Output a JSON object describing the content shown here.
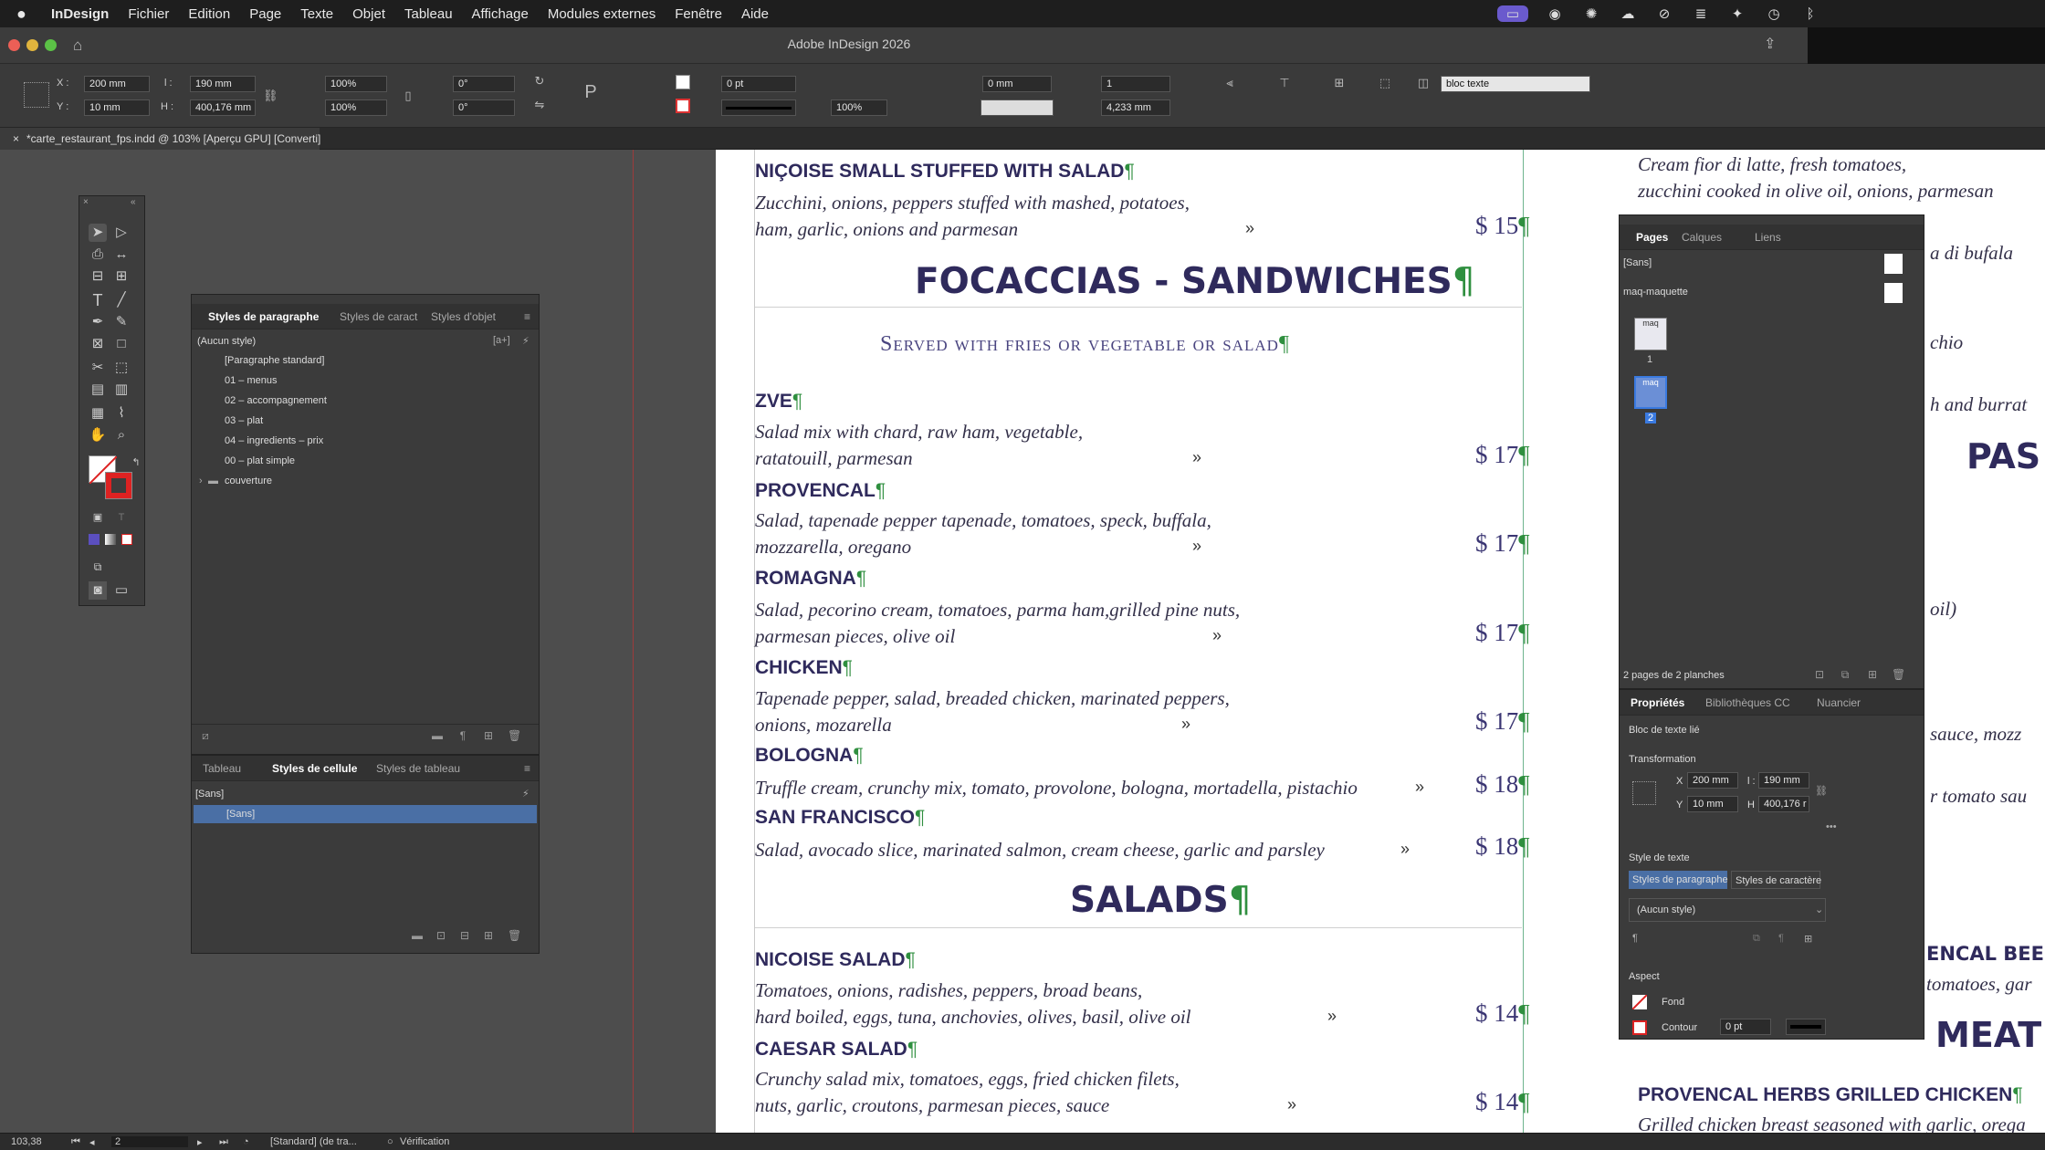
{
  "menubar": {
    "apple": "",
    "items": [
      "InDesign",
      "Fichier",
      "Edition",
      "Page",
      "Texte",
      "Objet",
      "Tableau",
      "Affichage",
      "Modules externes",
      "Fenêtre",
      "Aide"
    ]
  },
  "window": {
    "title": "Adobe InDesign 2026",
    "doc_tab": "*carte_restaurant_fps.indd @ 103% [Aperçu GPU] [Converti]"
  },
  "control": {
    "x": "200 mm",
    "y": "10 mm",
    "w": "190 mm",
    "h": "400,176 mm",
    "scale_x": "100%",
    "scale_y": "100%",
    "angle": "0°",
    "shear": "0°",
    "stroke": "0 pt",
    "spacing": "0 mm",
    "columns": "1",
    "gutter": "4,233 mm",
    "opacity": "100%",
    "style_field": "bloc texte",
    "x_lbl": "X :",
    "y_lbl": "Y :",
    "w_lbl": "l :",
    "h_lbl": "H :"
  },
  "menu": {
    "top_dish": "NIÇOISE SMALL STUFFED WITH SALAD",
    "top_desc1": "Zucchini, onions, peppers stuffed with mashed, potatoes,",
    "top_desc2": "ham, garlic, onions and parmesan",
    "top_price": "$ 15",
    "sec1": "FOCACCIAS - SANDWICHES",
    "sec1_sub": "Served with fries or vegetable or salad",
    "items": [
      {
        "name": "ZVE",
        "d1": "Salad mix with chard, raw ham, vegetable,",
        "d2": "ratatouill, parmesan",
        "price": "$ 17"
      },
      {
        "name": "PROVENCAL",
        "d1": "Salad, tapenade pepper tapenade, tomatoes, speck, buffala,",
        "d2": "mozzarella, oregano",
        "price": "$ 17"
      },
      {
        "name": "ROMAGNA",
        "d1": "Salad, pecorino cream, tomatoes, parma ham,grilled pine nuts,",
        "d2": "parmesan pieces, olive oil",
        "price": "$ 17"
      },
      {
        "name": "CHICKEN",
        "d1": "Tapenade pepper, salad, breaded chicken, marinated peppers,",
        "d2": "onions, mozarella",
        "price": "$ 17"
      },
      {
        "name": "BOLOGNA",
        "d1": "Truffle cream, crunchy mix, tomato, provolone, bologna, mortadella, pistachio",
        "d2": "",
        "price": "$ 18"
      },
      {
        "name": "SAN FRANCISCO",
        "d1": "Salad, avocado slice, marinated salmon, cream cheese, garlic and parsley",
        "d2": "",
        "price": "$ 18"
      }
    ],
    "sec2": "SALADS",
    "salads": [
      {
        "name": "NICOISE SALAD",
        "d1": "Tomatoes, onions, radishes, peppers, broad beans,",
        "d2": "hard boiled, eggs, tuna, anchovies, olives, basil, olive oil",
        "price": "$ 14"
      },
      {
        "name": "CAESAR SALAD",
        "d1": "Crunchy salad mix, tomatoes, eggs, fried chicken filets,",
        "d2": "nuts, garlic, croutons, parmesan pieces, sauce",
        "price": "$ 14"
      }
    ],
    "right": {
      "t1": "Cream fior di latte, fresh tomatoes,",
      "t2": "zucchini cooked in olive oil, onions, parmesan",
      "t3": "a di bufala",
      "t4": "chio",
      "t5": "h and burrat",
      "h1": "PAS",
      "t6": "oil)",
      "t7": "sauce, mozz",
      "t8": "r tomato sau",
      "h2": "ENCAL BEEF",
      "t9": "tomatoes, gar",
      "h3": "MEAT",
      "d1": "PROVENCAL HERBS GRILLED CHICKEN",
      "t10": "Grilled chicken breast seasoned with garlic, orega"
    }
  },
  "paragraph_panel": {
    "tabs": [
      "Styles de paragraphe",
      "Styles de caract",
      "Styles d'objet"
    ],
    "current": "(Aucun style)",
    "items": [
      "[Paragraphe standard]",
      "01 – menus",
      "02 – accompagnement",
      "03 – plat",
      "04 – ingredients – prix",
      "00 – plat simple",
      "couverture"
    ]
  },
  "cell_panel": {
    "tabs": [
      "Tableau",
      "Styles de cellule",
      "Styles de tableau"
    ],
    "current": "[Sans]",
    "items": [
      "[Sans]"
    ]
  },
  "pages_panel": {
    "tabs": [
      "Pages",
      "Calques",
      "Liens"
    ],
    "items": [
      "[Sans]",
      "maq-maquette"
    ],
    "thumb_label": "maq",
    "page1": "1",
    "page2": "2",
    "summary": "2 pages de 2 planches"
  },
  "props_panel": {
    "tabs": [
      "Propriétés",
      "Bibliothèques CC",
      "Nuancier"
    ],
    "object": "Bloc de texte lié",
    "transform": "Transformation",
    "x": "200 mm",
    "y": "10 mm",
    "w": "190 mm",
    "h": "400,176 r",
    "x_lbl": "X",
    "y_lbl": "Y",
    "w_lbl": "l :",
    "h_lbl": "H",
    "text_style": "Style de texte",
    "btn_para": "Styles de paragraphe",
    "btn_char": "Styles de caractère",
    "style_value": "(Aucun style)",
    "aspect": "Aspect",
    "fill": "Fond",
    "stroke": "Contour",
    "stroke_val": "0 pt"
  },
  "status": {
    "zoom": "103,38",
    "page": "2",
    "style": "[Standard] (de tra...",
    "preflight": "Vérification"
  }
}
